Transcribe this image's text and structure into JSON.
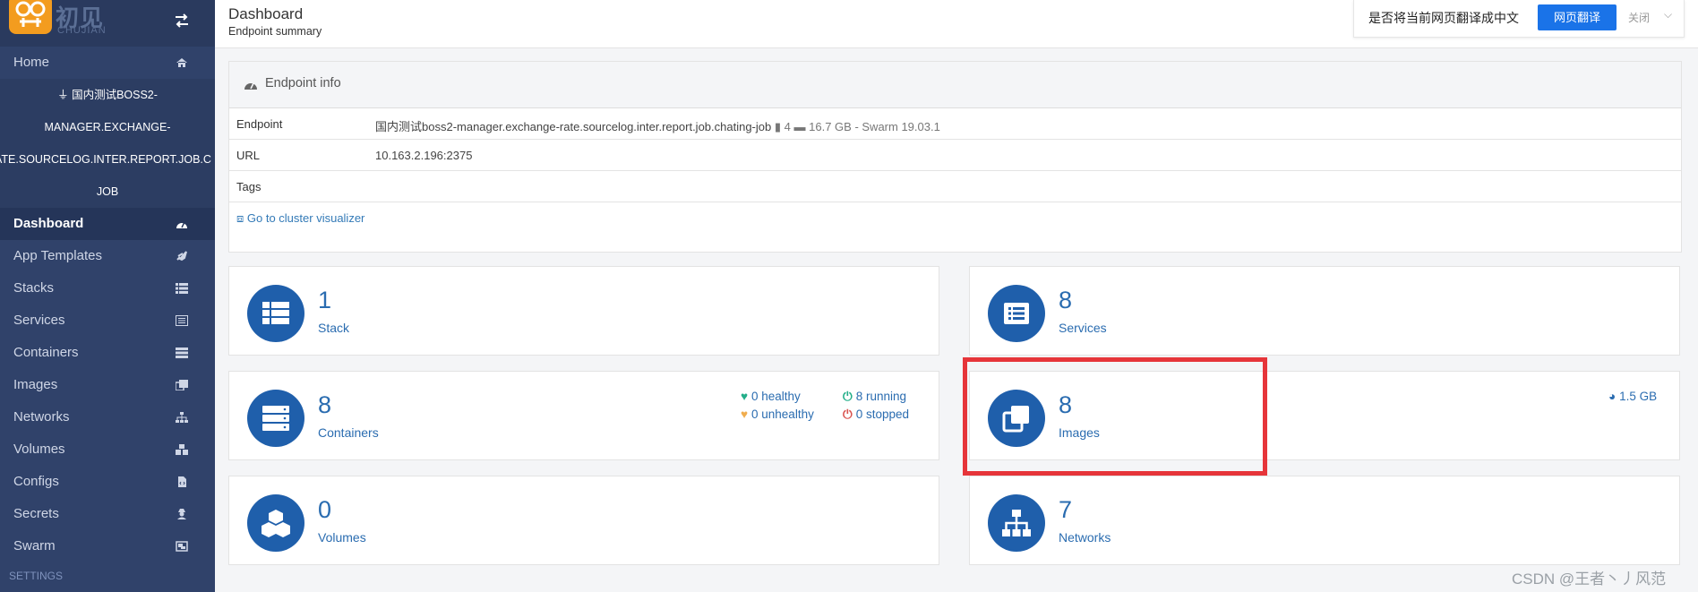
{
  "sidebar": {
    "logo_text": "初见",
    "logo_sub": "CHUJIAN",
    "items_top": [
      {
        "label": "Home",
        "icon": "home-icon"
      }
    ],
    "endpoint_lines": [
      "国内测试BOSS2-",
      "MANAGER.EXCHANGE-",
      "ATE.SOURCELOG.INTER.REPORT.JOB.C",
      "JOB"
    ],
    "items": [
      {
        "label": "Dashboard",
        "icon": "dashboard-icon",
        "active": true
      },
      {
        "label": "App Templates",
        "icon": "rocket-icon"
      },
      {
        "label": "Stacks",
        "icon": "th-list-icon"
      },
      {
        "label": "Services",
        "icon": "list-alt-icon"
      },
      {
        "label": "Containers",
        "icon": "server-icon"
      },
      {
        "label": "Images",
        "icon": "clone-icon"
      },
      {
        "label": "Networks",
        "icon": "sitemap-icon"
      },
      {
        "label": "Volumes",
        "icon": "cubes-icon"
      },
      {
        "label": "Configs",
        "icon": "file-code-icon"
      },
      {
        "label": "Secrets",
        "icon": "user-secret-icon"
      },
      {
        "label": "Swarm",
        "icon": "object-group-icon"
      }
    ],
    "settings_label": "SETTINGS"
  },
  "header": {
    "title": "Dashboard",
    "subtitle": "Endpoint summary"
  },
  "translate_bar": {
    "question": "是否将当前网页翻译成中文",
    "button": "网页翻译",
    "close": "关闭",
    "chevron": "⌵"
  },
  "endpoint_info": {
    "title": "Endpoint info",
    "rows": {
      "endpoint": {
        "key": "Endpoint",
        "value": "国内测试boss2-manager.exchange-rate.sourcelog.inter.report.job.chating-job",
        "cpu": "4",
        "memory": "16.7 GB - Swarm 19.03.1"
      },
      "url": {
        "key": "URL",
        "value": "10.163.2.196:2375"
      },
      "tags": {
        "key": "Tags",
        "value": ""
      }
    },
    "link": "Go to cluster visualizer"
  },
  "widgets": {
    "stack": {
      "value": "1",
      "label": "Stack"
    },
    "services": {
      "value": "8",
      "label": "Services"
    },
    "containers": {
      "value": "8",
      "label": "Containers",
      "healthy": "0 healthy",
      "running": "8 running",
      "unhealthy": "0 unhealthy",
      "stopped": "0 stopped"
    },
    "images": {
      "value": "8",
      "label": "Images",
      "size": "1.5 GB"
    },
    "volumes": {
      "value": "0",
      "label": "Volumes"
    },
    "networks": {
      "value": "7",
      "label": "Networks"
    }
  },
  "colors": {
    "sidebar_bg": "#30426a",
    "accent": "#2a6cb0",
    "icon_circle": "#1f5fab",
    "highlight": "#e6353a",
    "translate_button": "#1a73e8"
  },
  "watermark": "CSDN @王者丶丿风范"
}
